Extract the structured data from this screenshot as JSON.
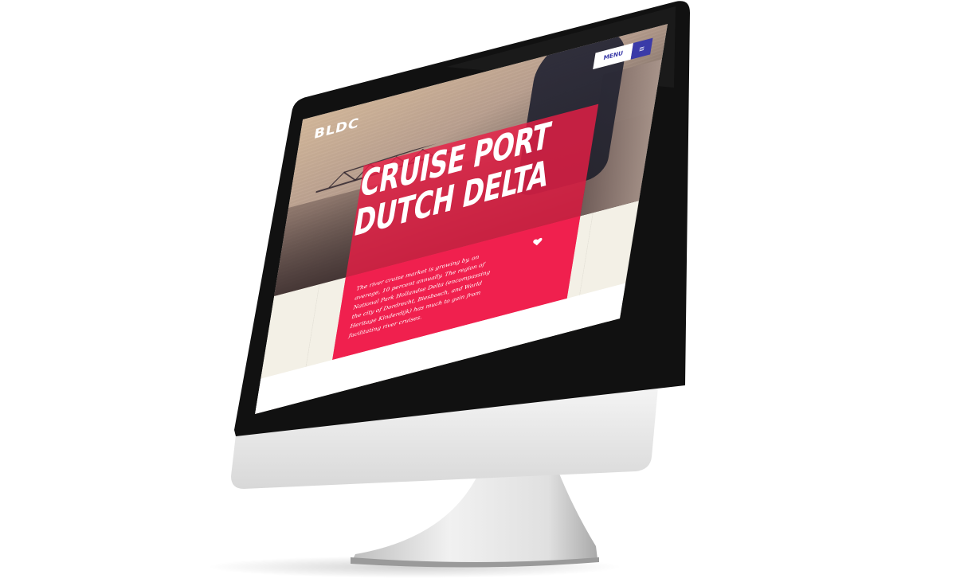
{
  "site": {
    "logo_text": "BLDC",
    "menu_label": "MENU",
    "menu_icon": "hamburger-icon",
    "hero_title": "CRUISE PORT DUTCH DELTA",
    "intro_text": "The river cruise market is growing by, on average, 10 percent annually. The region of National Park Hollandse Delta (encompassing the city of Dordrecht, Biesbosch, and World Heritage Kinderdijk) has much to gain from facilitating river cruises.",
    "heart_icon": "heart-icon"
  },
  "colors": {
    "accent_red": "#f0204e",
    "accent_blue": "#3a3aa8",
    "background_cream": "#f3f0e6"
  }
}
